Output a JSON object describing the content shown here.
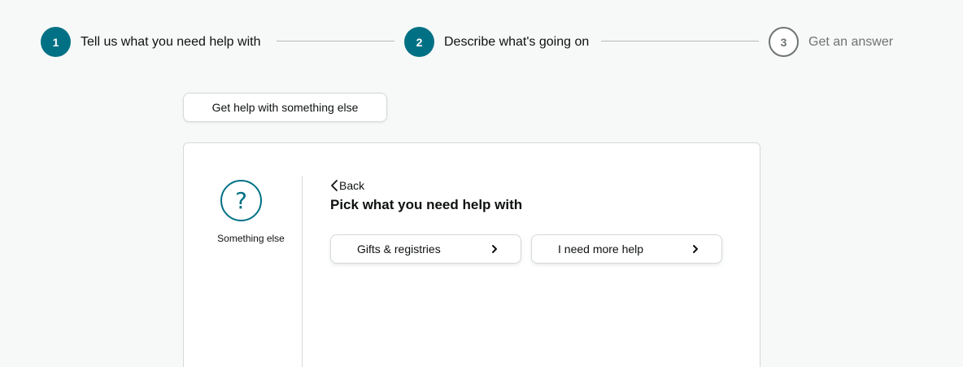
{
  "stepper": {
    "steps": [
      {
        "number": "1",
        "label": "Tell us what you need help with",
        "state": "active"
      },
      {
        "number": "2",
        "label": "Describe what's going on",
        "state": "active"
      },
      {
        "number": "3",
        "label": "Get an answer",
        "state": "inactive"
      }
    ]
  },
  "help_else_button": "Get help with something else",
  "card": {
    "topic_icon": "question-mark-icon",
    "topic_icon_glyph": "?",
    "topic_label": "Something else",
    "back_label": "Back",
    "title": "Pick what you need help with",
    "options": [
      {
        "label": "Gifts & registries"
      },
      {
        "label": "I need more help"
      }
    ]
  },
  "colors": {
    "accent": "#007185",
    "background": "#f7f8f8",
    "border": "#d5d9d9",
    "muted_text": "#6f7373"
  }
}
